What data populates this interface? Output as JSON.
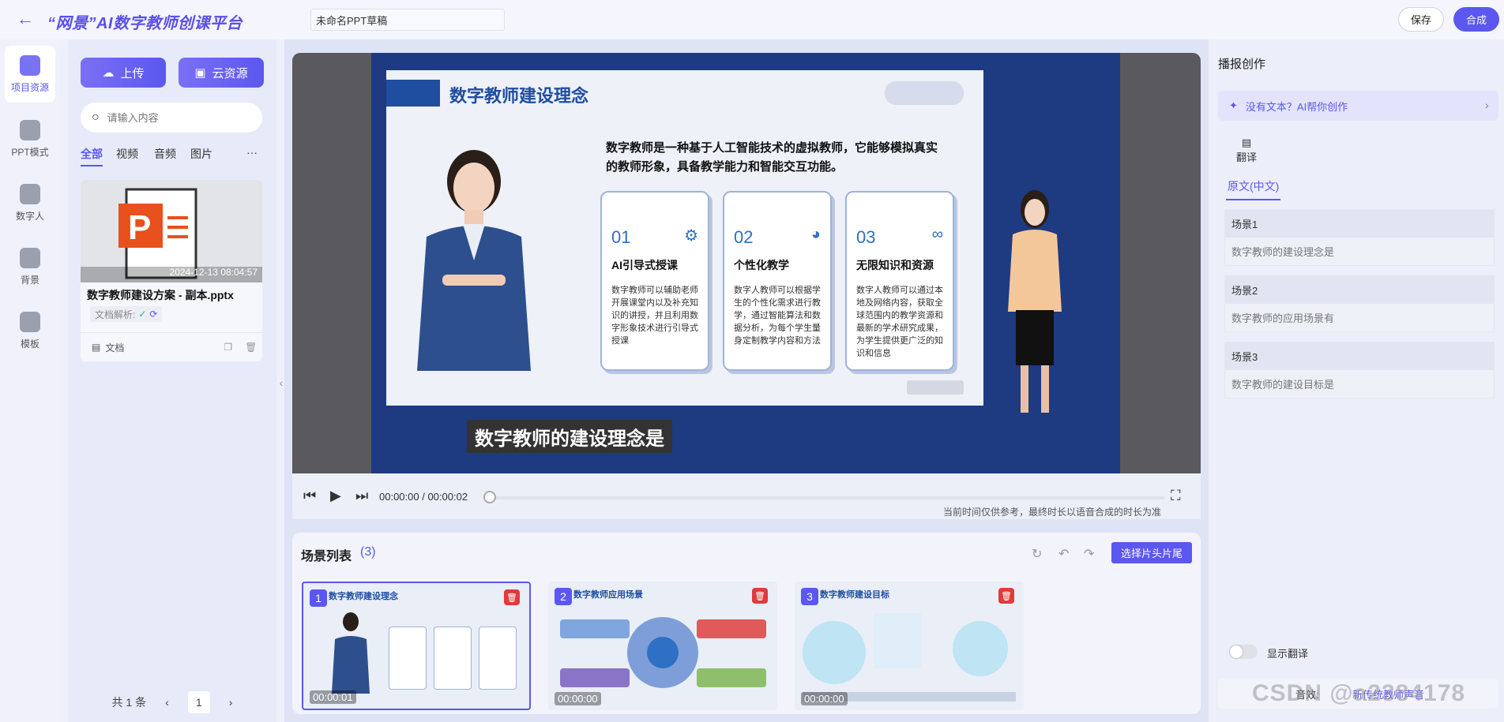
{
  "header": {
    "title": "“网景”AI数字教师创课平台",
    "draft_name": "未命名PPT草稿",
    "save_label": "保存",
    "compose_label": "合成"
  },
  "left_nav": {
    "items": [
      {
        "label": "项目资源",
        "icon": "folder-icon",
        "active": true
      },
      {
        "label": "PPT模式",
        "icon": "ppt-icon",
        "active": false
      },
      {
        "label": "数字人",
        "icon": "robot-icon",
        "active": false
      },
      {
        "label": "背景",
        "icon": "image-icon",
        "active": false
      },
      {
        "label": "模板",
        "icon": "cube-icon",
        "active": false
      }
    ]
  },
  "resources": {
    "upload_label": "上传",
    "cloud_label": "云资源",
    "search_placeholder": "请输入内容",
    "tabs": [
      "全部",
      "视频",
      "音频",
      "图片"
    ],
    "more": "···",
    "card": {
      "date": "2024-12-13 08:04:57",
      "name": "数字教师建设方案 - 副本.pptx",
      "parse_label": "文档解析:",
      "type_label": "文档"
    },
    "pagination": {
      "total": "共 1 条",
      "page": "1",
      "prev": "‹",
      "next": "›"
    }
  },
  "preview": {
    "slide_title": "数字教师建设理念",
    "slide_intro": "数字教师是一种基于人工智能技术的虚拟教师，它能够模拟真实的教师形象，具备教学能力和智能交互功能。",
    "cards": [
      {
        "num": "01",
        "title": "AI引导式授课",
        "body": "数字教师可以辅助老师开展课堂内以及补充知识的讲授，并且利用数字形象技术进行引导式授课"
      },
      {
        "num": "02",
        "title": "个性化教学",
        "body": "数字人教师可以根据学生的个性化需求进行教学，通过智能算法和数据分析，为每个学生量身定制教学内容和方法"
      },
      {
        "num": "03",
        "title": "无限知识和资源",
        "body": "数字人教师可以通过本地及网络内容，获取全球范围内的教学资源和最新的学术研究成果，为学生提供更广泛的知识和信息"
      }
    ],
    "subtitle": "数字教师的建设理念是",
    "time": "00:00:00 / 00:00:02",
    "progress": 0,
    "time_note": "当前时间仅供参考，最终时长以语音合成的时长为准"
  },
  "scenes": {
    "title": "场景列表",
    "count": "(3)",
    "choose_label": "选择片头片尾",
    "items": [
      {
        "index": "1",
        "title": "数字教师建设理念",
        "time": "00:00:01"
      },
      {
        "index": "2",
        "title": "数字教师应用场景",
        "time": "00:00:00"
      },
      {
        "index": "3",
        "title": "数字教师建设目标",
        "time": "00:00:00"
      }
    ]
  },
  "right": {
    "title": "播报创作",
    "ai_prompt": "没有文本？AI帮你创作",
    "translate_label": "翻译",
    "orig_tab": "原文(中文)",
    "scenes": [
      {
        "name": "场景1",
        "text": "数字教师的建设理念是"
      },
      {
        "name": "场景2",
        "text": "数字教师的应用场景有"
      },
      {
        "name": "场景3",
        "text": "数字教师的建设目标是"
      }
    ],
    "show_translate": "显示翻译",
    "voice_label": "音效:",
    "voice_value": "新传统教师声音"
  },
  "watermark": "CSDN @a2384178"
}
